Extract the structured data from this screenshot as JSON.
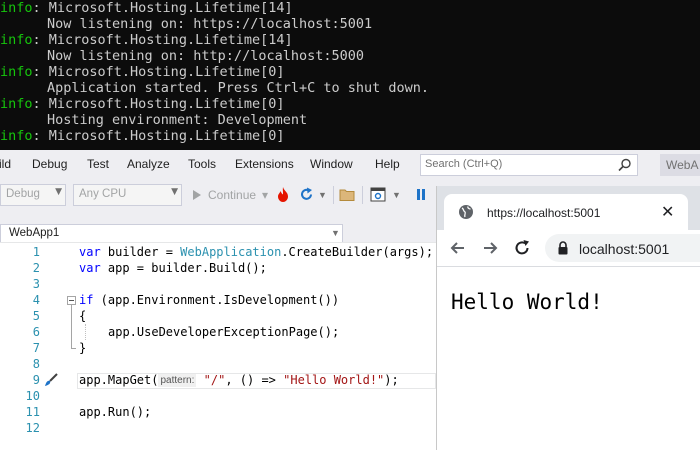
{
  "console": {
    "lines": [
      {
        "prefix": "info",
        "text": ": Microsoft.Hosting.Lifetime[14]"
      },
      {
        "text": "Now listening on: https://localhost:5001"
      },
      {
        "prefix": "info",
        "text": ": Microsoft.Hosting.Lifetime[14]"
      },
      {
        "text": "Now listening on: http://localhost:5000"
      },
      {
        "prefix": "info",
        "text": ": Microsoft.Hosting.Lifetime[0]"
      },
      {
        "text": "Application started. Press Ctrl+C to shut down."
      },
      {
        "prefix": "info",
        "text": ": Microsoft.Hosting.Lifetime[0]"
      },
      {
        "text": "Hosting environment: Development"
      },
      {
        "prefix": "info",
        "text": ": Microsoft.Hosting.Lifetime[0]"
      }
    ],
    "colors": {
      "background": "#0c0c0c",
      "text": "#cccccc",
      "info": "#16c60c"
    }
  },
  "vs": {
    "menu": [
      "ild",
      "Debug",
      "Test",
      "Analyze",
      "Tools",
      "Extensions",
      "Window",
      "Help"
    ],
    "search_placeholder": "Search (Ctrl+Q)",
    "solution_chip": "WebA",
    "toolbar": {
      "config": "Debug",
      "platform": "Any CPU",
      "continue_label": "Continue",
      "continue_arrow": "▾"
    },
    "document_tab": "WebApp1",
    "line_numbers": [
      "1",
      "2",
      "3",
      "4",
      "5",
      "6",
      "7",
      "8",
      "9",
      "10",
      "11",
      "12"
    ],
    "code": {
      "l1": {
        "kw": "var",
        "a": " builder = ",
        "ty": "WebApplication",
        "b": ".CreateBuilder(args);"
      },
      "l2": {
        "kw": "var",
        "a": " app = builder.Build();"
      },
      "l4": {
        "kw": "if",
        "a": " (app.Environment.IsDevelopment())"
      },
      "l5": "{",
      "l6": "app.UseDeveloperExceptionPage();",
      "l7": "}",
      "l9": {
        "a": "app.MapGet(",
        "hint": "pattern:",
        "s1": "\"/\"",
        "b": ", () => ",
        "s2": "\"Hello World!\"",
        "c": ");"
      },
      "l11": "app.Run();"
    },
    "colors": {
      "keyword": "#0000ff",
      "type": "#2b91af",
      "string": "#a31515",
      "line_number": "#2b91af"
    }
  },
  "browser": {
    "tab_title": "https://localhost:5001",
    "close_glyph": "✕",
    "address": "localhost:5001",
    "page_text": "Hello World!"
  }
}
